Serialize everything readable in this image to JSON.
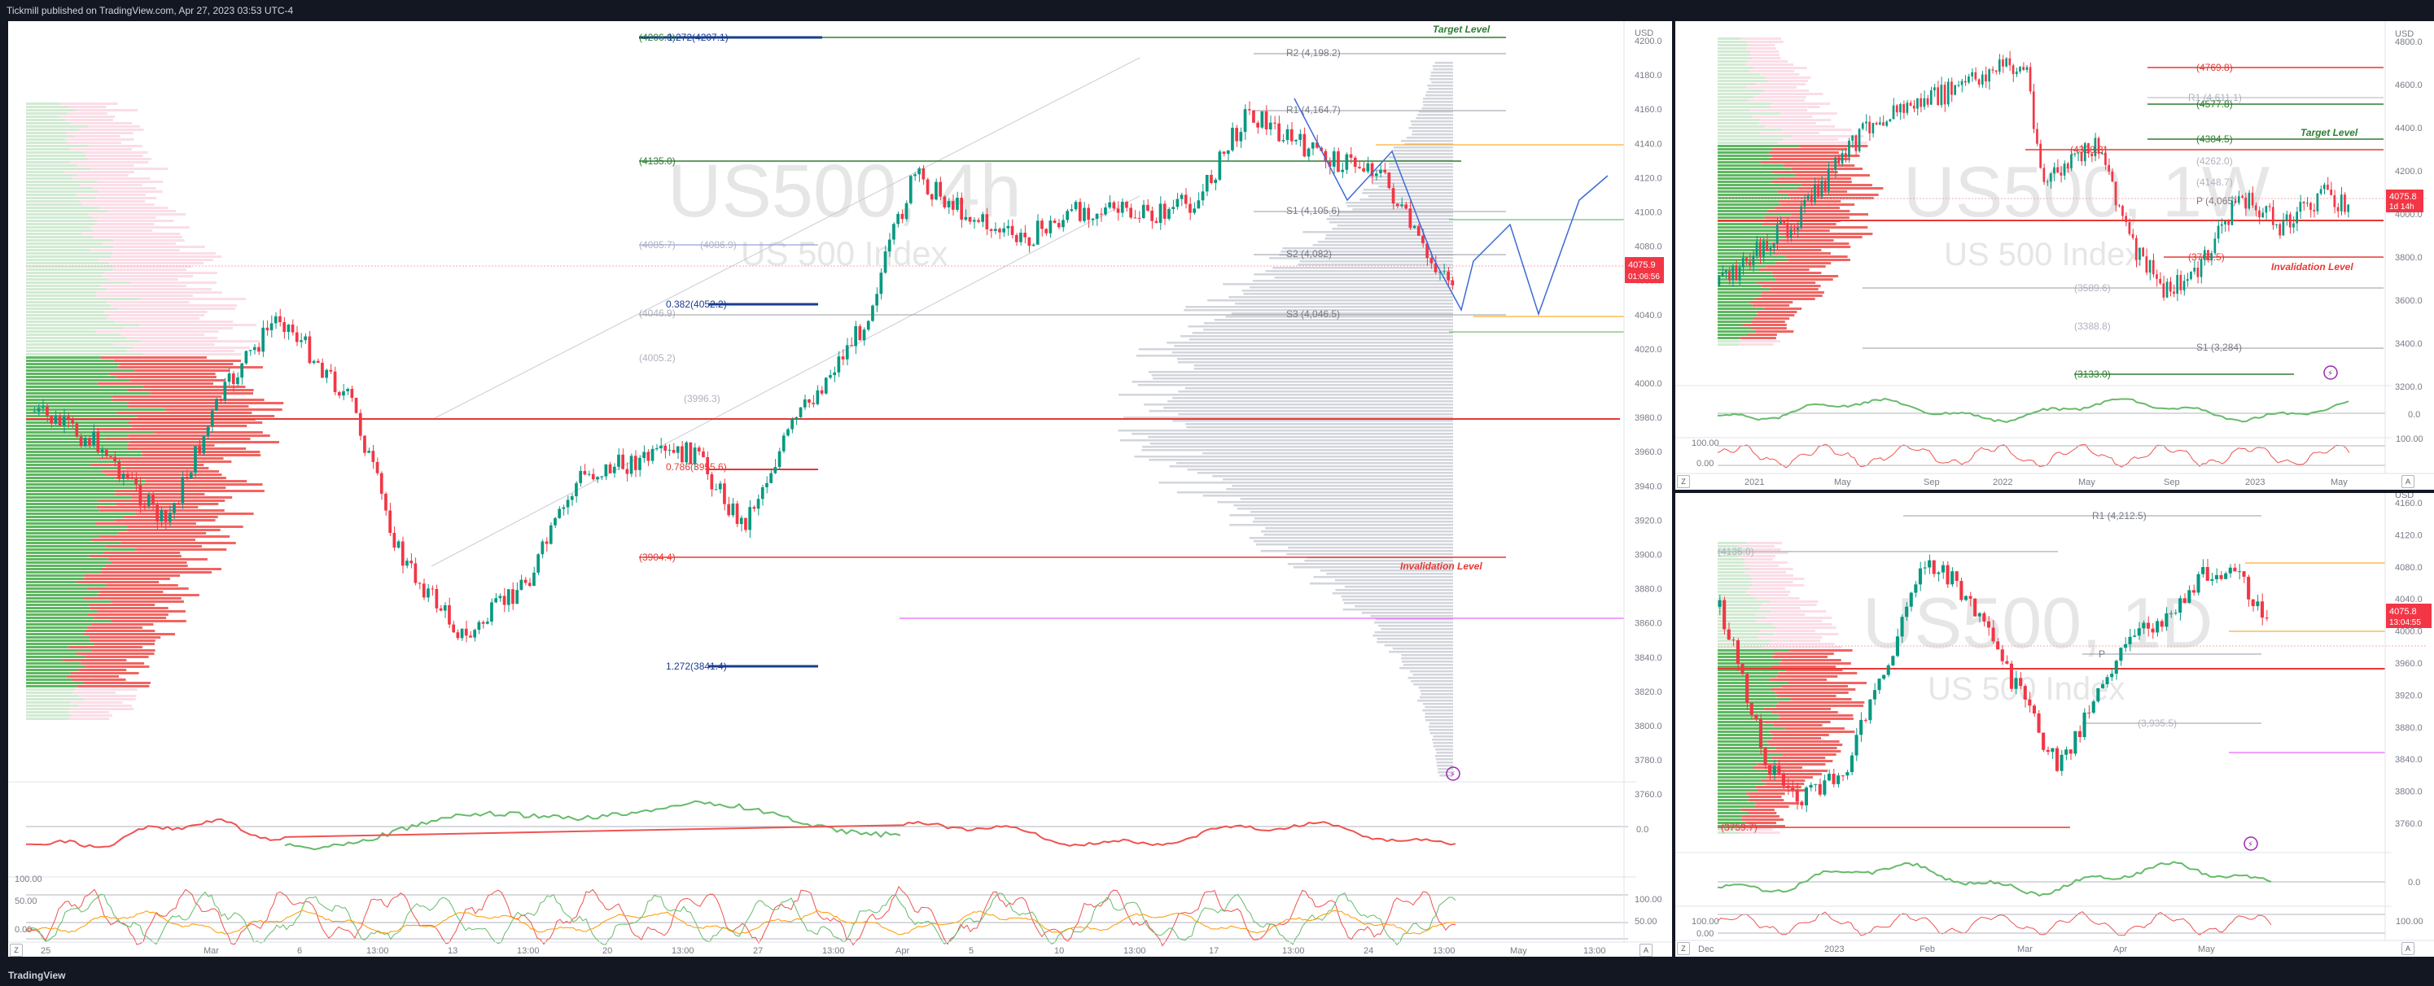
{
  "header": {
    "publisher": "Tickmill published on TradingView.com, Apr 27, 2023 03:53 UTC-4"
  },
  "footer": {
    "logo": "TradingView"
  },
  "main_chart": {
    "watermark_symbol": "US500, 4h",
    "watermark_name": "US 500 Index",
    "target_label": "Target Level",
    "invalidation_label": "Invalidation Level",
    "price_tag": "4075.9",
    "countdown": "01:06:56",
    "fib_labels": {
      "f1272_top": "1.272(4207.1)",
      "f4206": "(4206.0)",
      "f4135": "(4135.0)",
      "f4085": "(4085.7)",
      "f4086": "(4086.9)",
      "f0382": "0.382(4052.2)",
      "f4046": "(4046.9)",
      "f4005": "(4005.2)",
      "f3996": "(3996.3)",
      "f0786": "0.786(3955.6)",
      "f3904": "(3904.4)",
      "f1272_bot": "1.272(3841.4)"
    },
    "pivots": {
      "r2": "R2 (4,198.2)",
      "r1": "R1 (4,164.7)",
      "s1": "S1 (4,105.6)",
      "s2": "S2 (4,082)",
      "s3": "S3 (4,046.5)"
    },
    "y_axis": [
      "USD",
      "4200.0",
      "4180.0",
      "4160.0",
      "4140.0",
      "4120.0",
      "4100.0",
      "4080.0",
      "4060.0",
      "4040.0",
      "4020.0",
      "4000.0",
      "3980.0",
      "3960.0",
      "3940.0",
      "3920.0",
      "3900.0",
      "3880.0",
      "3860.0",
      "3840.0",
      "3820.0",
      "3800.0",
      "3780.0",
      "3760.0"
    ],
    "x_axis": [
      "25",
      "Mar",
      "6",
      "13:00",
      "13",
      "13:00",
      "20",
      "13:00",
      "27",
      "13:00",
      "Apr",
      "5",
      "10",
      "13:00",
      "17",
      "13:00",
      "24",
      "13:00",
      "May",
      "13:00"
    ],
    "osc_axis": [
      "0.0"
    ],
    "osc2_axis": [
      "100.00",
      "50.00",
      "0.00"
    ],
    "btn_z": "Z",
    "btn_a": "A"
  },
  "top_right_chart": {
    "watermark_symbol": "US500, 1W",
    "watermark_name": "US 500 Index",
    "target_label": "Target Level",
    "invalidation_label": "Invalidation Level",
    "price_tag": "4075.8",
    "countdown": "1d 14h",
    "labels": [
      "(4769.8)",
      "R1 (4,611.1)",
      "(4577.8)",
      "(4384.5)",
      "(4328.3)",
      "(4262.0)",
      "(4148.7)",
      "P (4,065)",
      "(3766.5)",
      "(3589.6)",
      "(3388.8)",
      "S1 (3,284)",
      "(3133.0)"
    ],
    "y_axis": [
      "USD",
      "4800.0",
      "4600.0",
      "4400.0",
      "4200.0",
      "4000.0",
      "3800.0",
      "3600.0",
      "3400.0",
      "3200.0"
    ],
    "x_axis": [
      "2021",
      "May",
      "Sep",
      "2022",
      "May",
      "Sep",
      "2023",
      "May"
    ],
    "osc_axis": [
      "0.0"
    ],
    "osc2_axis": [
      "100.00",
      "0.00"
    ],
    "btn_z": "Z",
    "btn_a": "A"
  },
  "bottom_right_chart": {
    "watermark_symbol": "US500, 1D",
    "watermark_name": "US 500 Index",
    "price_tag": "4075.8",
    "countdown": "13:04:55",
    "labels": [
      "R1 (4,212.5)",
      "(4135.0)",
      "P",
      "(3,935.5)",
      "(3759.7)"
    ],
    "y_axis": [
      "USD",
      "4160.0",
      "4120.0",
      "4080.0",
      "4040.0",
      "4000.0",
      "3960.0",
      "3920.0",
      "3880.0",
      "3840.0",
      "3800.0",
      "3760.0"
    ],
    "x_axis": [
      "Dec",
      "2023",
      "Feb",
      "Mar",
      "Apr",
      "May"
    ],
    "osc_axis": [
      "0.0"
    ],
    "osc2_axis": [
      "100.00",
      "0.00"
    ],
    "btn_z": "Z",
    "btn_a": "A"
  },
  "colors": {
    "up": "#089981",
    "down": "#f23645",
    "green_line": "#2e7d32",
    "red_line": "#e53935",
    "navy": "#1a3d8f",
    "orange": "#ff9800",
    "magenta": "#e040fb"
  }
}
